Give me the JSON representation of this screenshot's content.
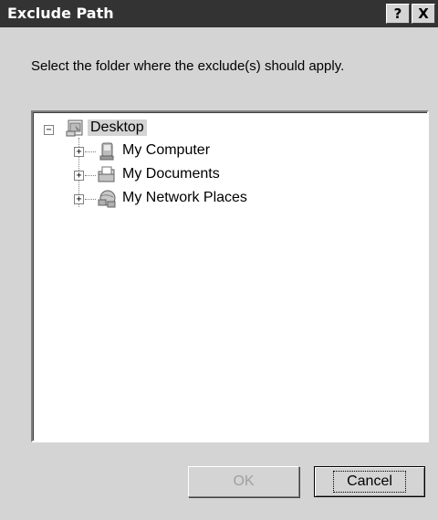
{
  "dialog": {
    "title": "Exclude Path",
    "help_label": "?",
    "close_label": "X",
    "instructions": "Select the folder where the exclude(s) should apply."
  },
  "tree": {
    "root": {
      "label": "Desktop",
      "expander": "−",
      "icon": "desktop-icon"
    },
    "children": [
      {
        "label": "My Computer",
        "expander": "+",
        "icon": "computer-icon"
      },
      {
        "label": "My Documents",
        "expander": "+",
        "icon": "documents-folder-icon"
      },
      {
        "label": "My Network Places",
        "expander": "+",
        "icon": "network-places-icon"
      }
    ]
  },
  "buttons": {
    "ok_label": "OK",
    "cancel_label": "Cancel"
  }
}
